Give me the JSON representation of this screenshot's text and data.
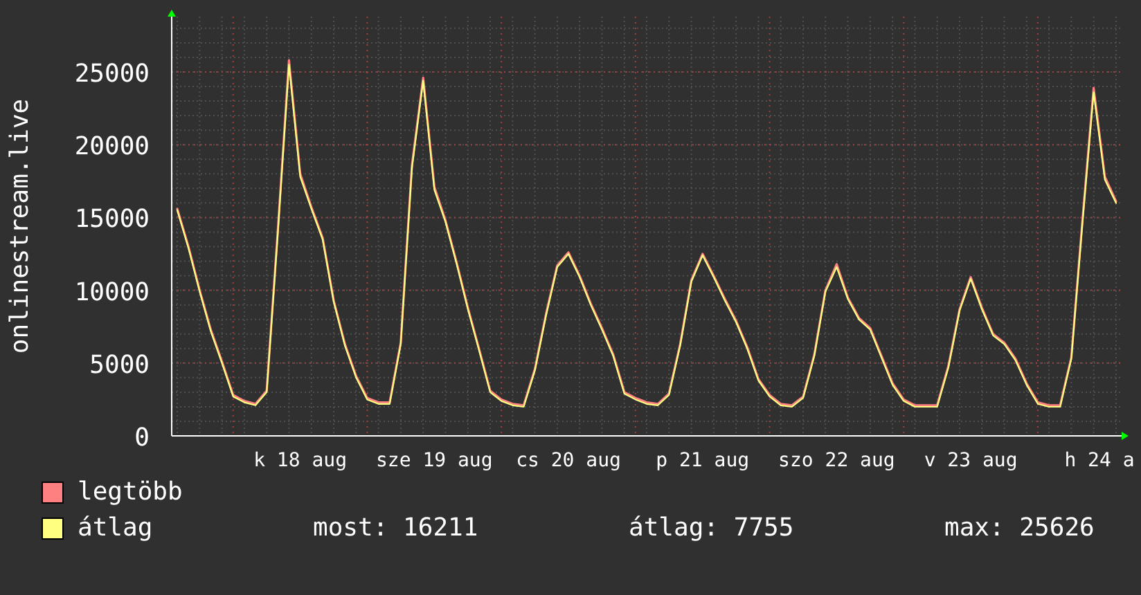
{
  "graph": {
    "chart_data": {
      "type": "line",
      "grid": true,
      "ylabel": "onlinestream.live",
      "ylim": [
        0,
        28800
      ],
      "yticks": [
        0,
        5000,
        10000,
        15000,
        20000,
        25000
      ],
      "categories": [
        null,
        null,
        null,
        null,
        null,
        null,
        null,
        null,
        null,
        null,
        null,
        "k 18 aug",
        null,
        null,
        null,
        null,
        null,
        null,
        null,
        null,
        null,
        null,
        null,
        "sze 19 aug",
        null,
        null,
        null,
        null,
        null,
        null,
        null,
        null,
        null,
        null,
        null,
        "cs 20 aug",
        null,
        null,
        null,
        null,
        null,
        null,
        null,
        null,
        null,
        null,
        null,
        "p 21 aug",
        null,
        null,
        null,
        null,
        null,
        null,
        null,
        null,
        null,
        null,
        null,
        "szo 22 aug",
        null,
        null,
        null,
        null,
        null,
        null,
        null,
        null,
        null,
        null,
        null,
        "v 23 aug",
        null,
        null,
        null,
        null,
        null,
        null,
        null,
        null,
        null,
        null,
        null,
        "h 24 a",
        null
      ],
      "series": [
        {
          "name": "legtöbb",
          "color": "#ff8080",
          "values": [
            15600,
            13000,
            10000,
            7300,
            5100,
            2800,
            2400,
            2200,
            3100,
            14200,
            25800,
            18000,
            15700,
            13600,
            9300,
            6300,
            4100,
            2600,
            2300,
            2300,
            6400,
            18600,
            24600,
            17100,
            14800,
            11900,
            8800,
            6000,
            3100,
            2500,
            2200,
            2100,
            4600,
            8400,
            11700,
            12600,
            11000,
            9100,
            7400,
            5600,
            3000,
            2600,
            2300,
            2200,
            2900,
            6300,
            10700,
            12500,
            11000,
            9400,
            7900,
            6100,
            3900,
            2800,
            2200,
            2100,
            2700,
            5600,
            10000,
            11800,
            9500,
            8100,
            7400,
            5500,
            3600,
            2500,
            2100,
            2100,
            2100,
            4800,
            8700,
            10900,
            8800,
            7000,
            6400,
            5300,
            3600,
            2300,
            2100,
            2100,
            5400,
            14900,
            23900,
            17800,
            16100
          ]
        },
        {
          "name": "átlag",
          "color": "#ffff80",
          "values": [
            15500,
            12900,
            9900,
            7200,
            5000,
            2700,
            2300,
            2100,
            3000,
            14000,
            25500,
            17800,
            15600,
            13500,
            9200,
            6200,
            4000,
            2500,
            2200,
            2200,
            6300,
            18400,
            24400,
            16900,
            14700,
            11800,
            8700,
            5900,
            3000,
            2400,
            2100,
            2000,
            4500,
            8300,
            11600,
            12500,
            10900,
            9000,
            7300,
            5500,
            2900,
            2500,
            2200,
            2100,
            2800,
            6200,
            10600,
            12400,
            10900,
            9300,
            7800,
            6000,
            3800,
            2700,
            2100,
            2000,
            2600,
            5500,
            9900,
            11600,
            9400,
            8000,
            7300,
            5400,
            3500,
            2400,
            2000,
            2000,
            2000,
            4700,
            8600,
            10800,
            8700,
            6900,
            6300,
            5200,
            3500,
            2200,
            2000,
            2000,
            5300,
            14700,
            23600,
            17600,
            16000
          ]
        }
      ]
    }
  },
  "legend": {
    "stats": [
      "most: 16211",
      "átlag: 7755",
      "max: 25626"
    ]
  }
}
